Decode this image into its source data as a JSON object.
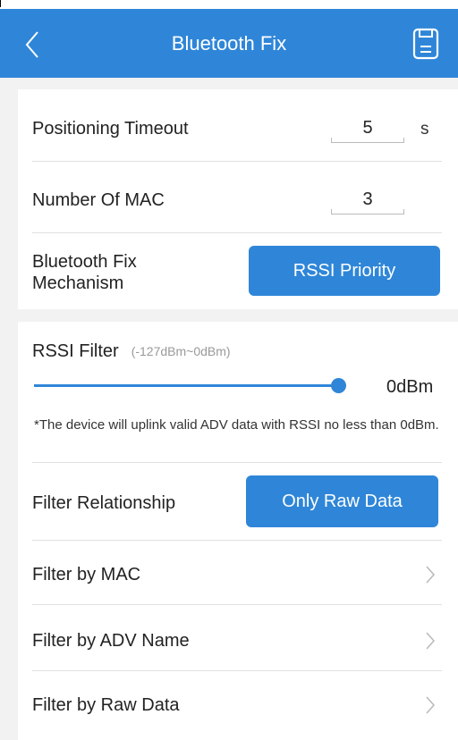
{
  "header": {
    "title": "Bluetooth Fix",
    "back_icon": "chevron-left-icon",
    "save_icon": "save-icon"
  },
  "positioning": {
    "timeout_label": "Positioning Timeout",
    "timeout_value": "5",
    "timeout_unit": "s",
    "mac_label": "Number Of MAC",
    "mac_value": "3",
    "mechanism_label_line1": "Bluetooth Fix",
    "mechanism_label_line2": "Mechanism",
    "mechanism_value": "RSSI Priority"
  },
  "filter": {
    "rssi_label": "RSSI Filter",
    "rssi_range": "(-127dBm~0dBm)",
    "rssi_value": "0dBm",
    "rssi_note": "*The device will uplink valid ADV data with RSSI no less than 0dBm.",
    "relationship_label": "Filter Relationship",
    "relationship_value": "Only Raw Data",
    "items": [
      {
        "label": "Filter by MAC"
      },
      {
        "label": "Filter by ADV Name"
      },
      {
        "label": "Filter by Raw Data"
      }
    ]
  },
  "colors": {
    "accent": "#2f86d8",
    "background": "#f2f2f2"
  }
}
